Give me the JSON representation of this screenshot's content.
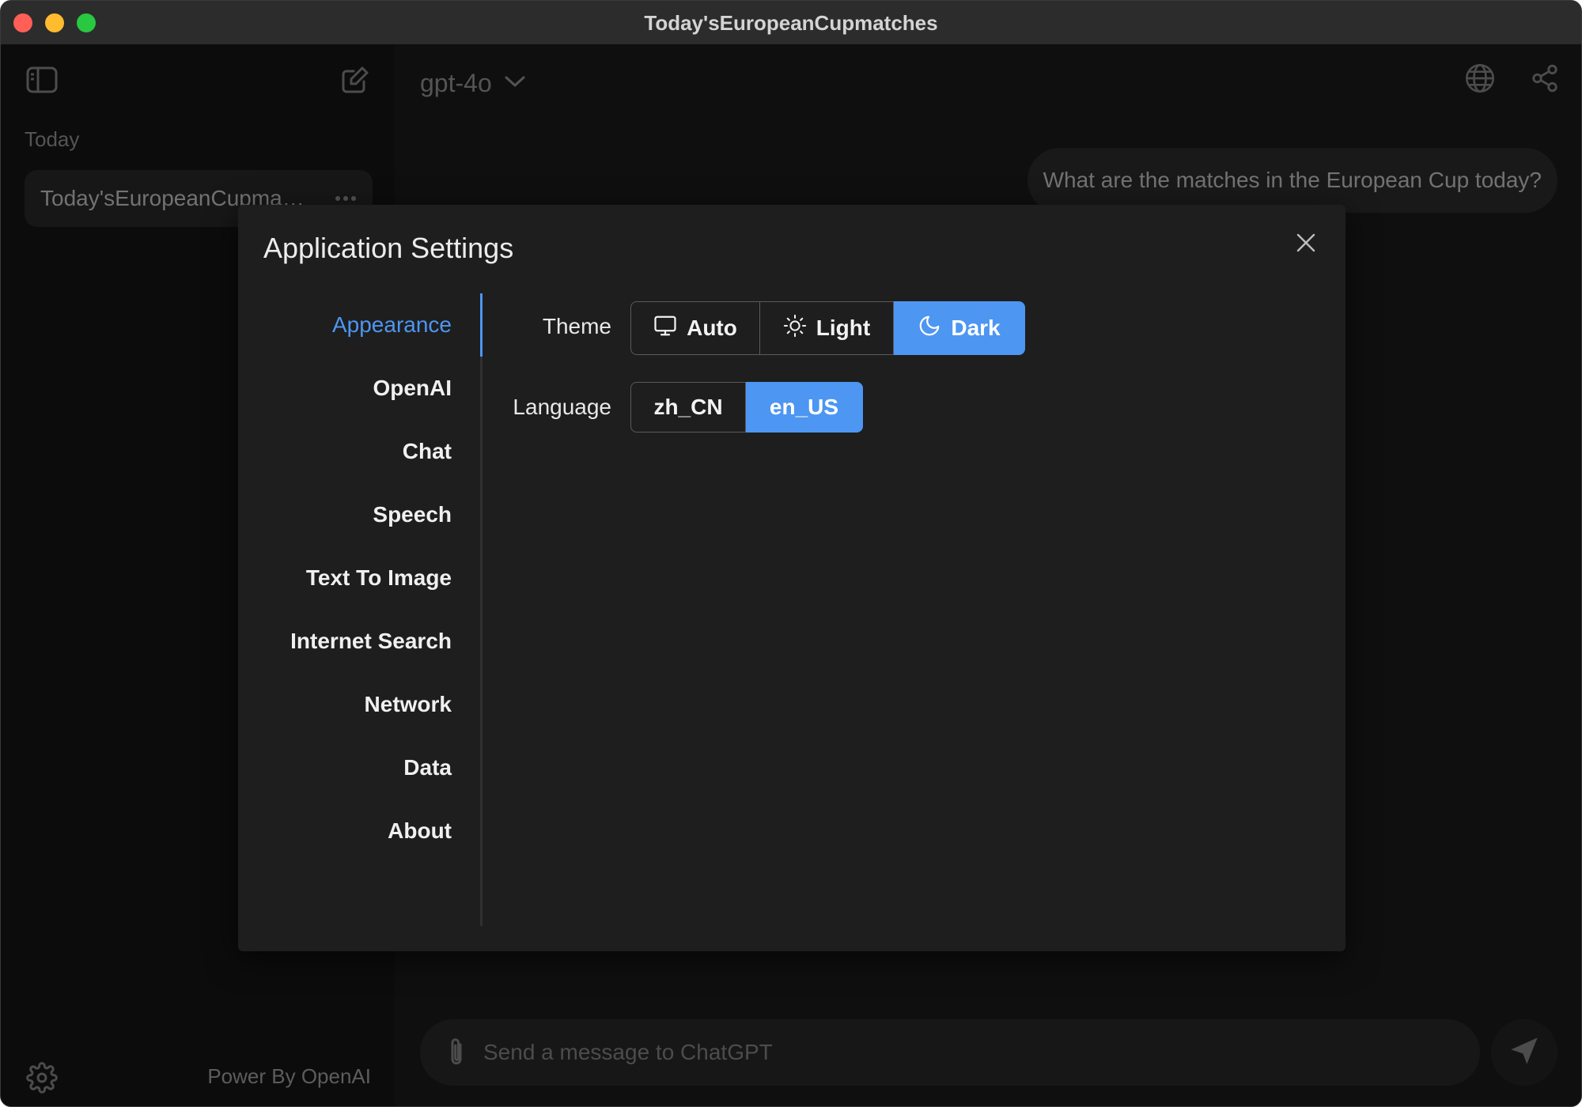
{
  "window": {
    "title": "Today'sEuropeanCupmatches"
  },
  "sidebar": {
    "section_label": "Today",
    "conversations": [
      {
        "title": "Today'sEuropeanCupmatches"
      }
    ],
    "footer_text": "Power By OpenAI"
  },
  "header": {
    "model": "gpt-4o"
  },
  "chat": {
    "messages": [
      {
        "role": "user",
        "text": "What are the matches in the European Cup today?"
      }
    ],
    "input_placeholder": "Send a message to ChatGPT"
  },
  "settings": {
    "title": "Application Settings",
    "nav": [
      "Appearance",
      "OpenAI",
      "Chat",
      "Speech",
      "Text To Image",
      "Internet Search",
      "Network",
      "Data",
      "About"
    ],
    "active_nav": "Appearance",
    "theme": {
      "label": "Theme",
      "options": [
        "Auto",
        "Light",
        "Dark"
      ],
      "selected": "Dark"
    },
    "language": {
      "label": "Language",
      "options": [
        "zh_CN",
        "en_US"
      ],
      "selected": "en_US"
    }
  },
  "colors": {
    "accent": "#4d96f2",
    "window_bg": "#171717",
    "modal_bg": "#1e1e1e"
  }
}
